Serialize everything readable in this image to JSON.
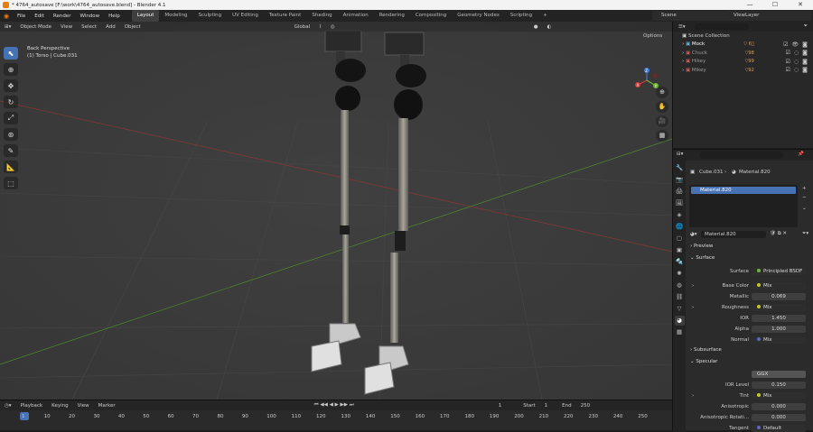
{
  "window": {
    "title": "* 4764_autosave [F:\\work\\4764_autosave.blend] - Blender 4.1",
    "min": "—",
    "max": "☐",
    "close": "✕"
  },
  "menu": [
    "File",
    "Edit",
    "Render",
    "Window",
    "Help"
  ],
  "workspaces": [
    "Layout",
    "Modeling",
    "Sculpting",
    "UV Editing",
    "Texture Paint",
    "Shading",
    "Animation",
    "Rendering",
    "Compositing",
    "Geometry Nodes",
    "Scripting",
    "+"
  ],
  "scene": "Scene",
  "view_layer": "ViewLayer",
  "viewport": {
    "mode": "Object Mode",
    "menus": [
      "View",
      "Select",
      "Add",
      "Object"
    ],
    "orientation": "Global",
    "options": "Options",
    "hud_line1": "Back Perspective",
    "hud_line2": "(1) Torso | Cube.031",
    "gizmo": {
      "x": "X",
      "y": "Y",
      "z": "Z"
    }
  },
  "timeline": {
    "menus": [
      "Playback",
      "Keying",
      "View",
      "Marker"
    ],
    "current": "1",
    "start_label": "Start",
    "start": "1",
    "end_label": "End",
    "end": "250",
    "frames": [
      "1",
      "10",
      "20",
      "30",
      "40",
      "50",
      "60",
      "70",
      "80",
      "90",
      "100",
      "110",
      "120",
      "130",
      "140",
      "150",
      "160",
      "170",
      "180",
      "190",
      "200",
      "210",
      "220",
      "230",
      "240",
      "250"
    ]
  },
  "outliner": {
    "root": "Scene Collection",
    "items": [
      {
        "name": "Mock",
        "mod": "▽ 6⃞"
      },
      {
        "name": "Chuck",
        "mod": "▽98"
      },
      {
        "name": "Hikey",
        "mod": "▽99"
      },
      {
        "name": "Mikey",
        "mod": "▽92"
      }
    ]
  },
  "properties": {
    "object": "Cube.031",
    "material": "Material.820",
    "slot": "Material.820",
    "mat_field": "Material.820",
    "sections": {
      "preview": "Preview",
      "surface": "Surface",
      "subsurface": "Subsurface",
      "specular": "Specular"
    },
    "rows": [
      {
        "label": "Surface",
        "value": "Principled BSDF"
      },
      {
        "label": "Base Color",
        "value": "Mix"
      },
      {
        "label": "Metallic",
        "value": "0.069"
      },
      {
        "label": "Roughness",
        "value": "Mix"
      },
      {
        "label": "IOR",
        "value": "1.450"
      },
      {
        "label": "Alpha",
        "value": "1.000"
      },
      {
        "label": "Normal",
        "value": "Mix"
      },
      {
        "label": "",
        "value": "GGX"
      },
      {
        "label": "IOR Level",
        "value": "0.150"
      },
      {
        "label": "Tint",
        "value": "Mix"
      },
      {
        "label": "Anisotropic",
        "value": "0.000"
      },
      {
        "label": "Anisotropic Rotati...",
        "value": "0.000"
      },
      {
        "label": "Tangent",
        "value": "Default"
      }
    ]
  },
  "colors": {
    "accent": "#4772b3",
    "x_axis": "#d73d3d",
    "y_axis": "#6cb833",
    "z_axis": "#3d7bd7"
  }
}
